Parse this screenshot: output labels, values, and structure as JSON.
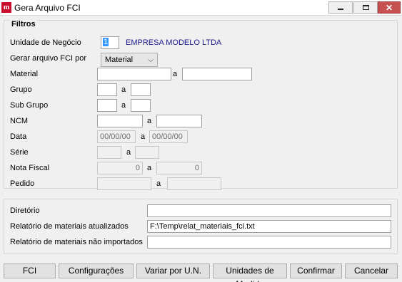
{
  "window": {
    "title": "Gera Arquivo FCI",
    "icon_glyph": "m",
    "close_glyph": "✕"
  },
  "filtros": {
    "title": "Filtros",
    "unidade_label": "Unidade de Negócio",
    "unidade_code": "1",
    "unidade_name": "EMPRESA MODELO LTDA",
    "gerar_label": "Gerar arquivo FCI por",
    "gerar_value": "Material",
    "material_label": "Material",
    "grupo_label": "Grupo",
    "subgrupo_label": "Sub Grupo",
    "ncm_label": "NCM",
    "data_label": "Data",
    "data_from": "00/00/00",
    "data_to": "00/00/00",
    "serie_label": "Série",
    "nota_label": "Nota Fiscal",
    "nota_from": "0",
    "nota_to": "0",
    "pedido_label": "Pedido",
    "range_sep": "a"
  },
  "diretorio": {
    "dir_label": "Diretório",
    "dir_value": "",
    "atualizados_label": "Relatório de materiais atualizados",
    "atualizados_value": "F:\\Temp\\relat_materiais_fci.txt",
    "nao_importados_label": "Relatório de materiais não importados",
    "nao_importados_value": ""
  },
  "buttons": {
    "fci_label": "FCI",
    "configuracoes_label": "Configurações",
    "variar_label": "Variar por U.N.",
    "unidades_label": "Unidades de Medida",
    "confirmar_label": "Confirmar",
    "cancelar_label": "Cancelar"
  }
}
